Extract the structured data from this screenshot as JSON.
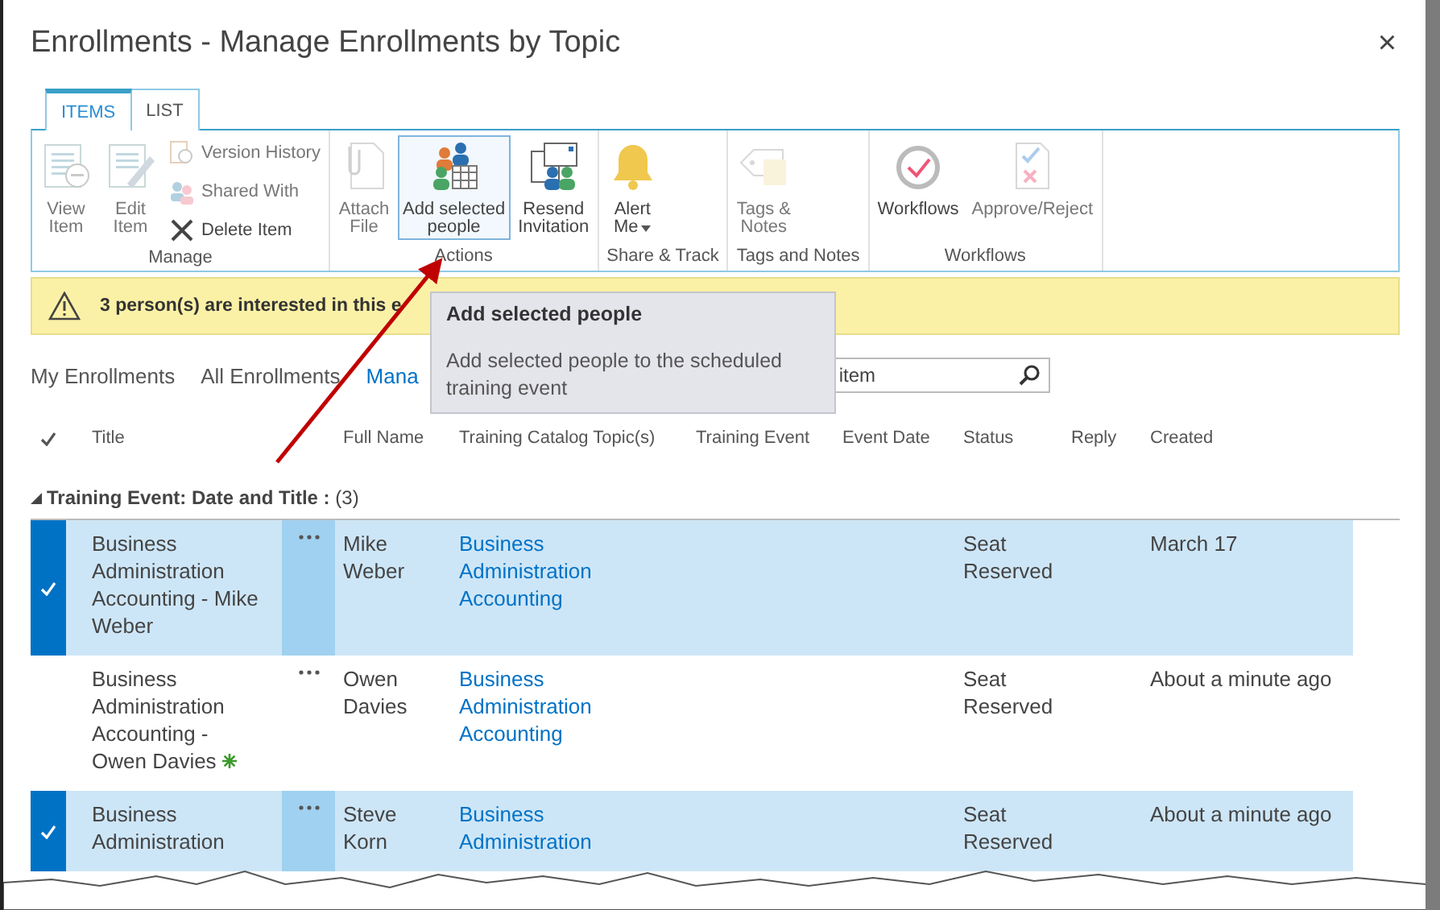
{
  "window": {
    "title": "Enrollments - Manage Enrollments by Topic",
    "close": "×"
  },
  "ribbon": {
    "tabs": [
      {
        "label": "ITEMS",
        "selected": true
      },
      {
        "label": "LIST",
        "selected": false
      }
    ],
    "groups": [
      {
        "label": "Manage",
        "buttons": [
          {
            "kind": "large",
            "lines": [
              "View",
              "Item"
            ],
            "disabled": true,
            "hovered": false
          },
          {
            "kind": "large",
            "lines": [
              "Edit",
              "Item"
            ],
            "disabled": true,
            "hovered": false
          },
          {
            "kind": "small",
            "lines": [
              "Version History"
            ],
            "disabled": true,
            "hovered": false
          },
          {
            "kind": "small",
            "lines": [
              "Shared With"
            ],
            "disabled": true,
            "hovered": false
          },
          {
            "kind": "small",
            "lines": [
              "Delete Item"
            ],
            "disabled": false,
            "hovered": false
          }
        ]
      },
      {
        "label": "Actions",
        "buttons": [
          {
            "kind": "large",
            "lines": [
              "Attach",
              "File"
            ],
            "disabled": true,
            "hovered": false
          },
          {
            "kind": "large",
            "lines": [
              "Add selected",
              "people"
            ],
            "disabled": false,
            "hovered": true
          },
          {
            "kind": "large",
            "lines": [
              "Resend",
              "Invitation"
            ],
            "disabled": false,
            "hovered": false
          }
        ]
      },
      {
        "label": "Share & Track",
        "buttons": [
          {
            "kind": "large",
            "lines": [
              "Alert",
              "Me"
            ],
            "dropdown": true,
            "disabled": false,
            "hovered": false
          }
        ]
      },
      {
        "label": "Tags and Notes",
        "buttons": [
          {
            "kind": "large",
            "lines": [
              "Tags &",
              "Notes"
            ],
            "disabled": true,
            "hovered": false
          }
        ]
      },
      {
        "label": "Workflows",
        "buttons": [
          {
            "kind": "large",
            "lines": [
              "Workflows"
            ],
            "disabled": false,
            "hovered": false
          },
          {
            "kind": "large",
            "lines": [
              "Approve/Reject"
            ],
            "disabled": true,
            "hovered": false
          }
        ]
      }
    ]
  },
  "tooltip": {
    "title": "Add selected people",
    "text": "Add selected people to the scheduled training event"
  },
  "notice": {
    "text": "3 person(s) are interested in this e"
  },
  "views": [
    {
      "label": "My Enrollments",
      "selected": false
    },
    {
      "label": "All Enrollments",
      "selected": false
    },
    {
      "label": "Mana",
      "selected": true
    }
  ],
  "search": {
    "value": "item"
  },
  "table": {
    "columns": [
      "Title",
      "Full Name",
      "Training Catalog Topic(s)",
      "Training Event",
      "Event Date",
      "Status",
      "Reply",
      "Created"
    ],
    "group": {
      "label": "**Training Event: Date and Title :** (3)",
      "expanded": true
    },
    "rows": [
      {
        "selected": true,
        "title": "Business Administration Accounting - Mike Weber",
        "is_new": false,
        "full_name": "Mike Weber",
        "topic": "Business Administration Accounting",
        "status": "Seat Reserved",
        "created": "March 17"
      },
      {
        "selected": false,
        "title": "Business Administration Accounting - Owen Davies",
        "is_new": true,
        "full_name": "Owen Davies",
        "topic": "Business Administration Accounting",
        "status": "Seat Reserved",
        "created": "About a minute ago"
      },
      {
        "selected": true,
        "title": "Business Administration",
        "is_new": false,
        "full_name": "Steve Korn",
        "topic": "Business Administration",
        "status": "Seat Reserved",
        "created": "About a minute ago"
      }
    ]
  }
}
